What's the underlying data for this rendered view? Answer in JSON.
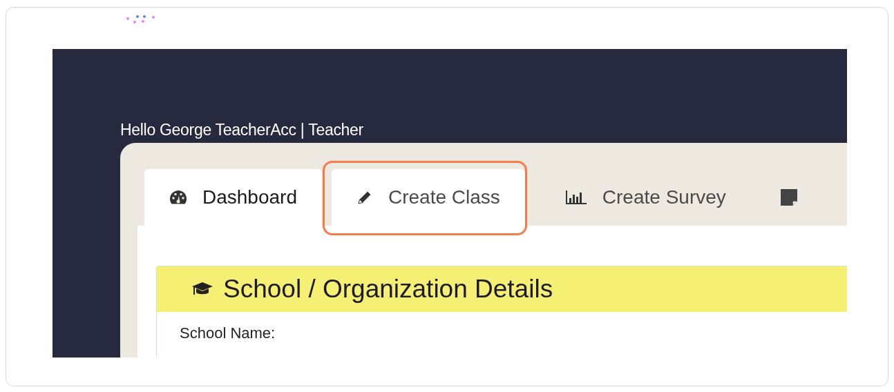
{
  "greeting": "Hello George TeacherAcc | Teacher",
  "tabs": [
    {
      "label": "Dashboard",
      "selected": true,
      "highlighted": false
    },
    {
      "label": "Create Class",
      "selected": false,
      "highlighted": true
    },
    {
      "label": "Create Survey",
      "selected": false,
      "highlighted": false
    },
    {
      "selected": false,
      "highlighted": false
    }
  ],
  "card": {
    "title": "School / Organization Details",
    "fields": [
      "School Name:"
    ]
  }
}
